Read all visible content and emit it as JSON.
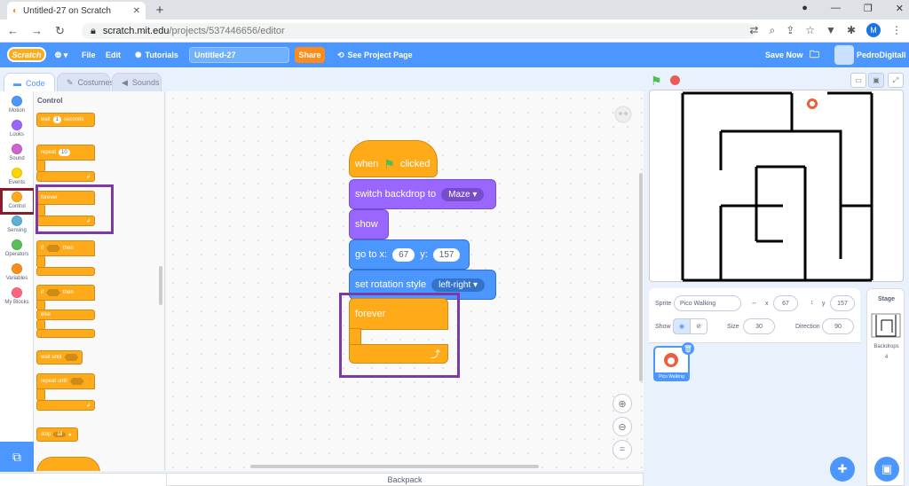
{
  "browser": {
    "tab_title": "Untitled-27 on Scratch",
    "url_host": "scratch.mit.edu",
    "url_path": "/projects/537446656/editor",
    "profile_initial": "M"
  },
  "menubar": {
    "logo": "Scratch",
    "file": "File",
    "edit": "Edit",
    "tutorials": "Tutorials",
    "project_title": "Untitled-27",
    "share": "Share",
    "see_project_page": "See Project Page",
    "save_now": "Save Now",
    "username": "PedroDigitall"
  },
  "tabs": {
    "code": "Code",
    "costumes": "Costumes",
    "sounds": "Sounds"
  },
  "categories": [
    {
      "label": "Motion",
      "color": "#4c97ff"
    },
    {
      "label": "Looks",
      "color": "#9966ff"
    },
    {
      "label": "Sound",
      "color": "#cf63cf"
    },
    {
      "label": "Events",
      "color": "#ffd500"
    },
    {
      "label": "Control",
      "color": "#ffab19"
    },
    {
      "label": "Sensing",
      "color": "#5cb1d6"
    },
    {
      "label": "Operators",
      "color": "#59c059"
    },
    {
      "label": "Variables",
      "color": "#ff8c1a"
    },
    {
      "label": "My Blocks",
      "color": "#ff6680"
    }
  ],
  "palette": {
    "heading": "Control",
    "wait": "wait",
    "wait_val": "1",
    "seconds": "seconds",
    "repeat": "repeat",
    "repeat_val": "10",
    "forever": "forever",
    "if": "if",
    "then": "then",
    "if2": "if",
    "then2": "then",
    "else": "else",
    "wait_until": "wait until",
    "repeat_until": "repeat until",
    "stop": "stop",
    "stop_val": "all"
  },
  "script": {
    "when": "when",
    "clicked": "clicked",
    "switch_backdrop": "switch backdrop to",
    "backdrop_val": "Maze",
    "show": "show",
    "goto": "go to x:",
    "x_val": "67",
    "y_lbl": "y:",
    "y_val": "157",
    "rotation": "set rotation style",
    "rotation_val": "left-right",
    "forever": "forever"
  },
  "backpack": "Backpack",
  "sprite_info": {
    "sprite_lbl": "Sprite",
    "sprite_name": "Pico Walking",
    "x_lbl": "x",
    "x_val": "67",
    "y_lbl": "y",
    "y_val": "157",
    "show_lbl": "Show",
    "size_lbl": "Size",
    "size_val": "30",
    "direction_lbl": "Direction",
    "direction_val": "90"
  },
  "sprite_card_name": "Pico Walking",
  "stage_panel": {
    "title": "Stage",
    "backdrops_lbl": "Backdrops",
    "backdrops_count": "4"
  }
}
